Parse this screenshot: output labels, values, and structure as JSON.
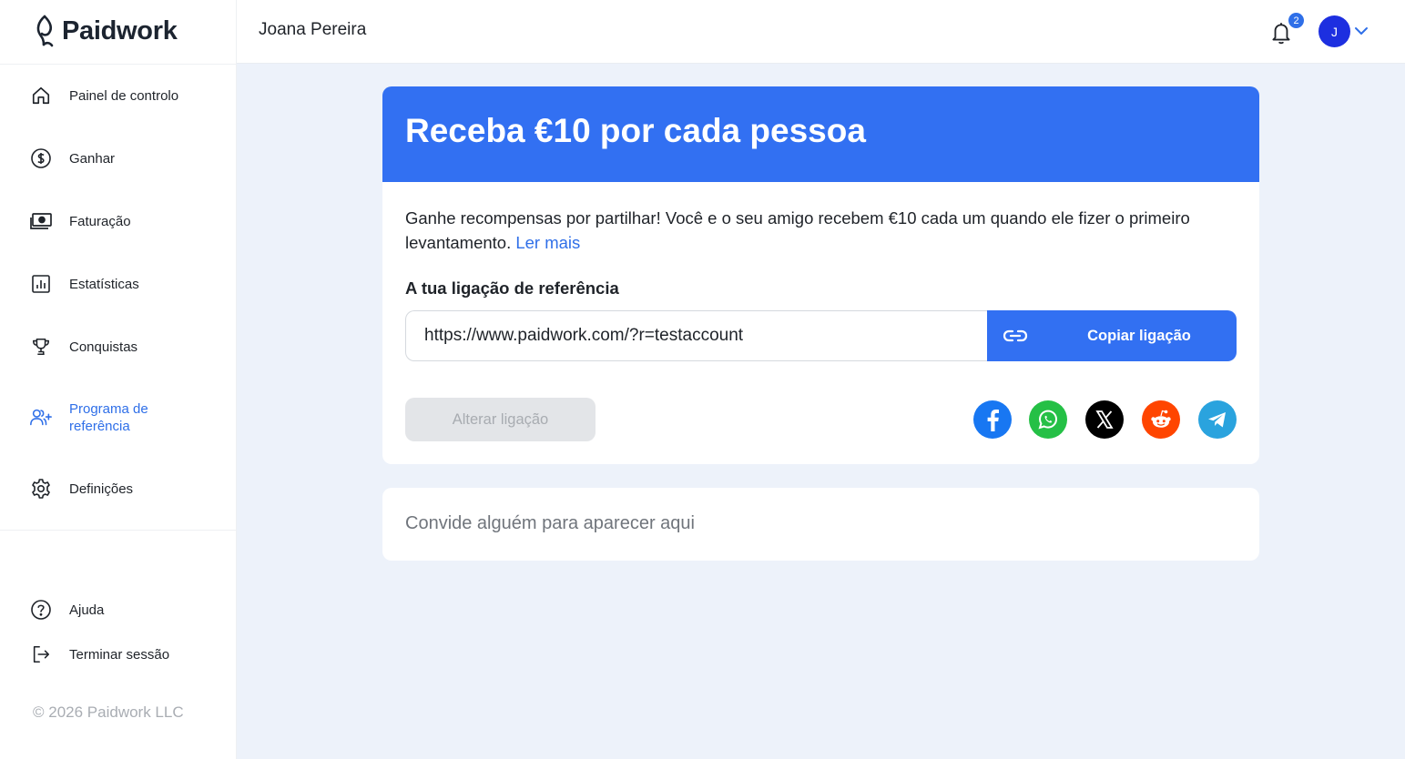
{
  "app": {
    "name": "Paidwork",
    "copyright": "© 2026 Paidwork LLC"
  },
  "sidebar": {
    "items": [
      {
        "label": "Painel de controlo",
        "icon": "home-icon"
      },
      {
        "label": "Ganhar",
        "icon": "dollar-circle-icon"
      },
      {
        "label": "Faturação",
        "icon": "banknote-icon"
      },
      {
        "label": "Estatísticas",
        "icon": "bar-chart-icon"
      },
      {
        "label": "Conquistas",
        "icon": "trophy-icon"
      },
      {
        "label": "Programa de referência",
        "icon": "user-plus-icon",
        "active": true
      },
      {
        "label": "Definições",
        "icon": "gear-icon"
      }
    ],
    "bottom_items": [
      {
        "label": "Ajuda",
        "icon": "help-circle-icon"
      },
      {
        "label": "Terminar sessão",
        "icon": "logout-icon"
      }
    ]
  },
  "header": {
    "user_name": "Joana Pereira",
    "notification_count": "2",
    "avatar_initial": "J"
  },
  "referral": {
    "title": "Receba €10 por cada pessoa",
    "description": "Ganhe recompensas por partilhar! Você e o seu amigo recebem €10 cada um quando ele fizer o primeiro levantamento.",
    "read_more": "Ler mais",
    "link_label": "A tua ligação de referência",
    "link_value": "https://www.paidwork.com/?r=testaccount",
    "copy_label": "Copiar ligação",
    "change_label": "Alterar ligação",
    "share_networks": [
      "facebook-icon",
      "whatsapp-icon",
      "x-icon",
      "reddit-icon",
      "telegram-icon"
    ]
  },
  "invites": {
    "empty_message": "Convide alguém para aparecer aqui"
  },
  "colors": {
    "accent": "#3270f2",
    "avatar": "#1d2fe0",
    "background": "#edf2fa"
  }
}
